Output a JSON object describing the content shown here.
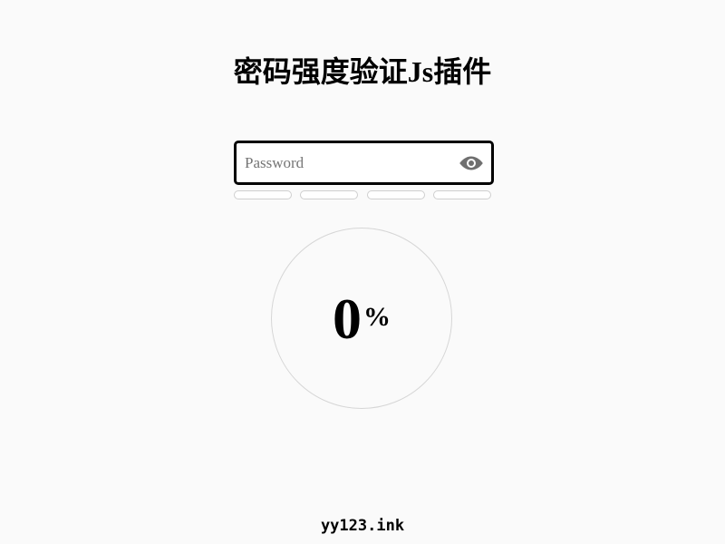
{
  "page": {
    "title": "密码强度验证Js插件"
  },
  "password": {
    "placeholder": "Password",
    "value": "",
    "toggle_icon": "eye-icon"
  },
  "strength": {
    "bars_filled": 0,
    "bars_total": 4,
    "percent_value": "0",
    "percent_sign": "%"
  },
  "footer": {
    "text": "yy123.ink"
  },
  "colors": {
    "background": "#fafafa",
    "input_border": "#000000",
    "bar_border": "#cfcfcf",
    "circle_border": "#d6d6d6",
    "icon": "#6f6f6f"
  }
}
